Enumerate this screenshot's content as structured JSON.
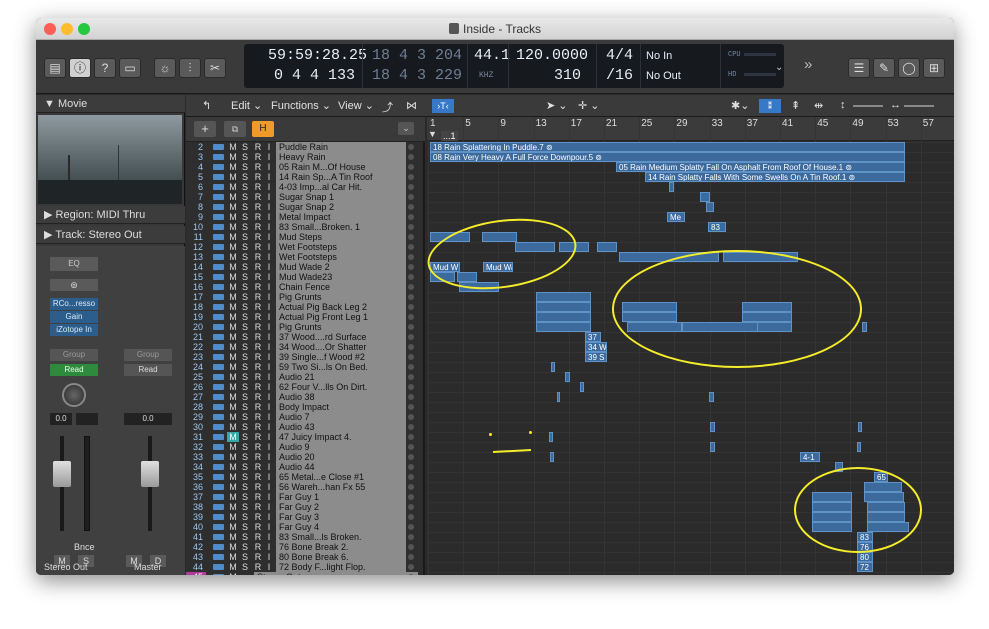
{
  "window": {
    "title": "Inside - Tracks"
  },
  "lcd": {
    "time_top": "59:59:28.25",
    "time_bot": "0 4 4 133",
    "pos_top": "18 4 3 204",
    "pos_bot": "18 4 3 229",
    "sample_rate": "44.1",
    "sample_unit": "KHZ",
    "tempo": "120.0000",
    "tempo_sub": "310",
    "sig": "4/4",
    "sig_sub": "/16",
    "in": "No In",
    "out": "No Out",
    "cpu": "CPU",
    "hd": "HD"
  },
  "inspector": {
    "movie": "Movie",
    "region": "Region: MIDI Thru",
    "track": "Stereo Out",
    "eq": "EQ",
    "link": "⊚",
    "plugins": [
      "RCo...resso",
      "Gain",
      "iZotope In"
    ],
    "group1": "Group",
    "group2": "Group",
    "read1": "Read",
    "read2": "Read",
    "vol1": "0.0",
    "vol2": "0.0",
    "bnce": "Bnce",
    "m": "M",
    "s": "S",
    "m2": "M",
    "d": "D",
    "out1": "Stereo Out",
    "out2": "Master"
  },
  "toolbar": {
    "edit": "Edit",
    "functions": "Functions",
    "view": "View"
  },
  "ruler": [
    "1",
    "5",
    "9",
    "13",
    "17",
    "21",
    "25",
    "29",
    "33",
    "37",
    "41",
    "45",
    "49",
    "53",
    "57"
  ],
  "marker": "...1",
  "tracks": [
    {
      "n": "2",
      "name": "Puddle Rain"
    },
    {
      "n": "3",
      "name": "Heavy Rain"
    },
    {
      "n": "4",
      "name": "05 Rain M...Of House"
    },
    {
      "n": "5",
      "name": "14 Rain Sp...A Tin Roof"
    },
    {
      "n": "6",
      "name": "4-03 Imp...al Car Hit."
    },
    {
      "n": "7",
      "name": "Sugar Snap 1"
    },
    {
      "n": "8",
      "name": "Sugar Snap 2"
    },
    {
      "n": "9",
      "name": "Metal Impact"
    },
    {
      "n": "10",
      "name": "83 Small...Broken. 1"
    },
    {
      "n": "11",
      "name": "Mud Steps"
    },
    {
      "n": "12",
      "name": "Wet Footsteps"
    },
    {
      "n": "13",
      "name": "Wet Footsteps"
    },
    {
      "n": "14",
      "name": "Mud Wade 2"
    },
    {
      "n": "15",
      "name": "Mud Wade23"
    },
    {
      "n": "16",
      "name": "Chain Fence"
    },
    {
      "n": "17",
      "name": "Pig Grunts"
    },
    {
      "n": "18",
      "name": "Actual Pig Back Leg 2"
    },
    {
      "n": "19",
      "name": "Actual Pig Front Leg 1"
    },
    {
      "n": "20",
      "name": "Pig Grunts"
    },
    {
      "n": "21",
      "name": "37 Wood....rd Surface"
    },
    {
      "n": "22",
      "name": "34 Wood....Or Shatter"
    },
    {
      "n": "23",
      "name": "39 Single...f Wood #2"
    },
    {
      "n": "24",
      "name": "59 Two Si...ls On Bed."
    },
    {
      "n": "25",
      "name": "Audio 21"
    },
    {
      "n": "26",
      "name": "62 Four V...lls On Dirt."
    },
    {
      "n": "27",
      "name": "Audio 38"
    },
    {
      "n": "28",
      "name": "Body Impact"
    },
    {
      "n": "29",
      "name": "Audio 7"
    },
    {
      "n": "30",
      "name": "Audio 43"
    },
    {
      "n": "31",
      "name": "47 Juicy Impact 4."
    },
    {
      "n": "32",
      "name": "Audio 9"
    },
    {
      "n": "33",
      "name": "Audio 20"
    },
    {
      "n": "34",
      "name": "Audio 44"
    },
    {
      "n": "35",
      "name": "65 Metal...e Close #1"
    },
    {
      "n": "36",
      "name": "56 Wareh...han Fx 55"
    },
    {
      "n": "37",
      "name": "Far Guy 1"
    },
    {
      "n": "38",
      "name": "Far Guy 2"
    },
    {
      "n": "39",
      "name": "Far Guy 3"
    },
    {
      "n": "40",
      "name": "Far Guy 4"
    },
    {
      "n": "41",
      "name": "83 Small...ls Broken."
    },
    {
      "n": "42",
      "name": "76 Bone Break 2."
    },
    {
      "n": "43",
      "name": "80 Bone Break 6."
    },
    {
      "n": "44",
      "name": "72 Body F...light Flop."
    },
    {
      "n": "45",
      "name": "Stereo Out"
    }
  ],
  "regions": {
    "r1": "18 Rain Splattering In Puddle.7 ⊚",
    "r2": "08 Rain Very Heavy A Full Force Downpour.5 ⊚",
    "r3": "05 Rain Medium Splatty Fall On Asphalt From Roof Of House.1 ⊚",
    "r4": "14 Rain Splatty Falls With Some Swells On A Tin Roof.1 ⊚",
    "me": "Me",
    "n83": "83",
    "mudw1": "Mud W",
    "mudw2": "Mud Wade",
    "l37": "37",
    "l34": "34 W",
    "l39": "39 S",
    "l41": "4-1",
    "l65": "65",
    "b83": "83",
    "b76": "76",
    "b80": "80",
    "b72": "72"
  }
}
